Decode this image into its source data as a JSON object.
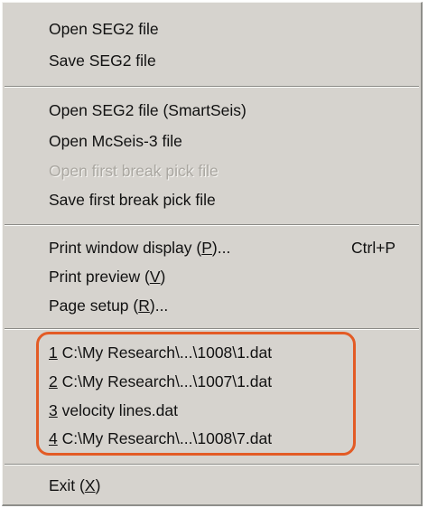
{
  "menu": {
    "group1": {
      "open_seg2": "Open SEG2 file",
      "save_seg2": "Save SEG2 file"
    },
    "group2": {
      "open_seg2_smartseis": "Open SEG2 file (SmartSeis)",
      "open_mcseis3": "Open McSeis-3 file",
      "open_first_break": "Open first break pick file",
      "save_first_break": "Save first break pick file"
    },
    "group3": {
      "print_window_display": {
        "label_pre": "Print window display (",
        "key": "P",
        "label_post": ")...",
        "shortcut": "Ctrl+P"
      },
      "print_preview": {
        "label_pre": "Print preview (",
        "key": "V",
        "label_post": ")"
      },
      "page_setup": {
        "label_pre": "Page setup (",
        "key": "R",
        "label_post": ")..."
      }
    },
    "recent_files": [
      {
        "num": "1",
        "path": " C:\\My Research\\...\\1008\\1.dat"
      },
      {
        "num": "2",
        "path": " C:\\My Research\\...\\1007\\1.dat"
      },
      {
        "num": "3",
        "path": " velocity lines.dat"
      },
      {
        "num": "4",
        "path": " C:\\My Research\\...\\1008\\7.dat"
      }
    ],
    "exit": {
      "label_pre": "Exit (",
      "key": "X",
      "label_post": ")"
    }
  },
  "colors": {
    "menu_background": "#d6d3ce",
    "highlight_border": "#e35b25"
  }
}
